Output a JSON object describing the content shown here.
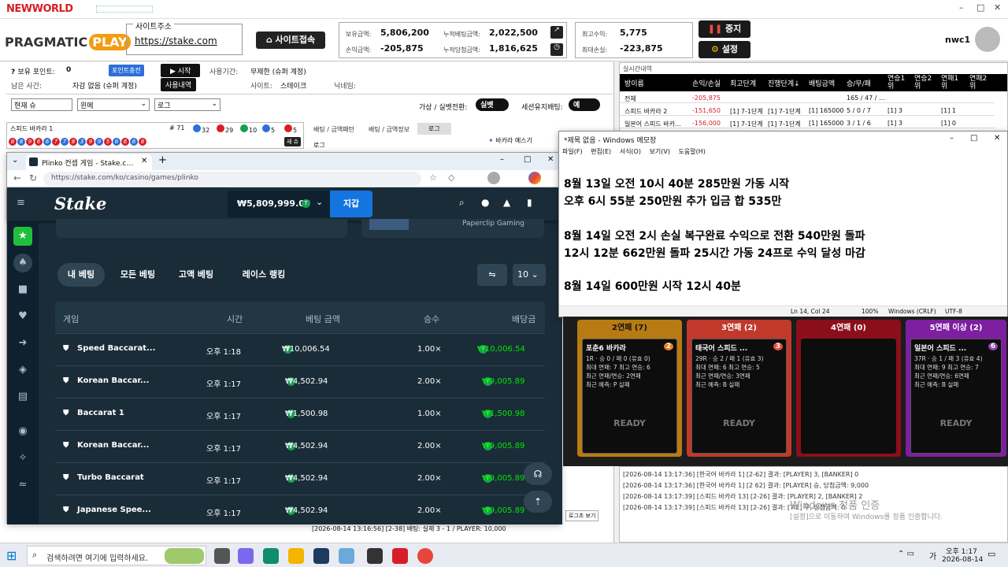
{
  "app": {
    "logo": "NEWWORLD",
    "window_controls": [
      "–",
      "□",
      "✕"
    ]
  },
  "header": {
    "brand": "PRAGMATIC",
    "brand_badge": "PLAY",
    "site_label": "사이트주소",
    "site_url": "https://stake.com",
    "connect_button": "사이트접속",
    "stats": {
      "holding_label": "보유금액:",
      "holding": "5,806,200",
      "profit_label": "손익금액:",
      "profit": "-205,875",
      "cum_bet_label": "누적배팅금액:",
      "cum_bet": "2,022,500",
      "cum_win_label": "누적당첨금액:",
      "cum_win": "1,816,625"
    },
    "max_profit_label": "최고수익:",
    "max_profit": "5,775",
    "max_loss_label": "최대손실:",
    "max_loss": "-223,875",
    "stop_button": "중지",
    "settings_button": "설정",
    "username": "nwc1"
  },
  "left": {
    "points_label": "보유 포인트:",
    "points": "0",
    "charge_button": "포인트충전",
    "start_button": "▶ 시작",
    "period_label": "사용기간:",
    "period": "무제한 (슈퍼 계정)",
    "remain_label": "남은 사간:",
    "remain": "자감 없음 (슈퍼 계정)",
    "history_button": "사용내역",
    "site_label": "사이트:",
    "site": "스테이크",
    "nick_label": "닉네임:",
    "selects": [
      "현재 슈",
      "윈메",
      "로그"
    ],
    "virtual_label": "가상 / 실벳전환:",
    "virtual_toggle": "실벳",
    "session_label": "세션유지배팅:",
    "session_toggle": "예",
    "game_name": "스피드 바카라 1",
    "counts": [
      "# 71",
      "32",
      "29",
      "10",
      "5",
      "5"
    ],
    "beads": [
      "8",
      "8",
      "9",
      "6",
      "6",
      "7",
      "7",
      "8",
      "3",
      "9",
      "9",
      "5",
      "6",
      "6",
      "6",
      "8"
    ],
    "shoe_button": "새 슈",
    "tabs": [
      "배팅 / 금액패턴",
      "배팅 / 금액정보",
      "로그"
    ],
    "log_label": "로그",
    "baccarat_tab": "바카라 예스기",
    "bottom_log": "[2026-08-14 13:16:56] [2-38] 배팅: 실제 3 - 1 / PLAYER: 10,000",
    "log_btn": "로그초 보기"
  },
  "realtime": {
    "title": "실시간내역",
    "headers": [
      "방이름",
      "손익/손실",
      "최고단계",
      "진행단계↓",
      "배팅금액",
      "승/무/패",
      "연승1위",
      "연승2위",
      "연패1위",
      "연패2위"
    ],
    "rows": [
      [
        "전체",
        "-205,875",
        "",
        "",
        "",
        "165 / 47 / ...",
        "",
        "",
        "",
        ""
      ],
      [
        "스피드 바카라 2",
        "-151,650",
        "[1] 7-1단계",
        "[1] 7-1단계",
        "[1] 165000",
        "5 / 0 / 7",
        "[1] 3",
        "",
        "[1] 1",
        ""
      ],
      [
        "일본어 스피드 바카...",
        "-156,000",
        "[1] 7-1단계",
        "[1] 7-1단계",
        "[1] 165000",
        "3 / 1 / 6",
        "[1] 3",
        "",
        "[1] 0",
        ""
      ]
    ]
  },
  "browser": {
    "tab_title": "Plinko 컨셉 게임 - Stake.com에서",
    "url": "https://stake.com/ko/casino/games/plinko",
    "balance": "₩5,809,999.03",
    "wallet_button": "지갑",
    "promo_text": "Paperclip Gaming",
    "bet_tabs": [
      "내 베팅",
      "모든 베팅",
      "고액 베팅",
      "레이스 랭킹"
    ],
    "page_size": "10",
    "columns": [
      "게임",
      "시간",
      "베팅 금액",
      "승수",
      "배당금"
    ],
    "rows": [
      {
        "game": "Speed Baccarat...",
        "time": "오후 1:18",
        "bet": "₩10,006.54",
        "mult": "1.00×",
        "payout": "₩10,006.54"
      },
      {
        "game": "Korean Baccar...",
        "time": "오후 1:17",
        "bet": "₩4,502.94",
        "mult": "2.00×",
        "payout": "₩9,005.89"
      },
      {
        "game": "Baccarat 1",
        "time": "오후 1:17",
        "bet": "₩1,500.98",
        "mult": "1.00×",
        "payout": "₩1,500.98"
      },
      {
        "game": "Korean Baccar...",
        "time": "오후 1:17",
        "bet": "₩4,502.94",
        "mult": "2.00×",
        "payout": "₩9,005.89"
      },
      {
        "game": "Turbo Baccarat",
        "time": "오후 1:17",
        "bet": "₩4,502.94",
        "mult": "2.00×",
        "payout": "₩9,005.89"
      },
      {
        "game": "Japanese Spee...",
        "time": "오후 1:17",
        "bet": "₩4,502.94",
        "mult": "2.00×",
        "payout": "₩9,005.89"
      }
    ]
  },
  "notepad": {
    "title": "*제목 없음 - Windows 메모장",
    "menu": [
      "파일(F)",
      "편집(E)",
      "서식(O)",
      "보기(V)",
      "도움말(H)"
    ],
    "lines": [
      "8월 13일 오전 10시 40분 285만원 가동 시작",
      "오후 6시 55분 250만원 추가 입금 합 535만",
      "",
      "8월 14일 오전 2시 손실 복구완료 수익으로 전환 540만원 돌파",
      "12시 12분 662만원 돌파 25시간 가동 24프로 수익 달성 마감",
      "",
      "8월 14일 600만원 시작 12시 40분"
    ],
    "status": [
      "Ln 14, Col 24",
      "100%",
      "Windows (CRLF)",
      "UTF-8"
    ]
  },
  "cards": [
    {
      "head": "2연패 (7)",
      "title": "포춘6 바카라",
      "badge": "2",
      "l1": "1R · 승 0 / 패 0 (유효 0)",
      "l2": "최대 연패: 7  최고 연승: 6",
      "l3": "최근 연패/연승: 2연패",
      "l4": "최근 예측: P 실패",
      "ready": "READY"
    },
    {
      "head": "3연패 (2)",
      "title": "태국어 스피드 ...",
      "badge": "3",
      "l1": "29R · 승 2 / 패 1 (유효 3)",
      "l2": "최대 연패: 6  최고 연승: 5",
      "l3": "최근 연패/연승: 3연패",
      "l4": "최근 예측: B 실패",
      "ready": "READY"
    },
    {
      "head": "4연패 (0)",
      "title": "",
      "badge": "",
      "l1": "",
      "l2": "",
      "l3": "",
      "l4": "",
      "ready": ""
    },
    {
      "head": "5연패 이상 (2)",
      "title": "일본어 스피드 ...",
      "badge": "6",
      "l1": "37R · 승 1 / 패 3 (유효 4)",
      "l2": "최대 연패: 9  최고 연승: 7",
      "l3": "최근 연패/연승: 6연패",
      "l4": "최근 예측: B 실패",
      "ready": "READY"
    }
  ],
  "logs": [
    "[2026-08-14 13:17:36] [한국어 바카라 1] [2-62] 결과: [PLAYER] 3, [BANKER] 0",
    "[2026-08-14 13:17:36] [한국어 바카라 1] [2 62] 결과: [PLAYER] 승, 당첨금액: 9,000",
    "[2026-08-14 13:17:39] [스피드 바카라 13] [2-26] 결과: [PLAYER] 2, [BANKER] 2",
    "[2026-08-14 13:17:39] [스피드 바카라 13] [2-26] 결과: [TIE] 무, 당첨금액: 0"
  ],
  "watermark": [
    "Windows 정품 인증",
    "[설정]으로 이동하여 Windows를 정품 인증합니다."
  ],
  "taskbar": {
    "search": "검색하려면 여기에 입력하세요.",
    "time": "오후 1:17",
    "date": "2026-08-14",
    "lang": "가"
  },
  "colors": {
    "stake_bg": "#1a2c38",
    "stake_green": "#00e701",
    "wallet_blue": "#1475e1",
    "red": "#d61f26"
  }
}
